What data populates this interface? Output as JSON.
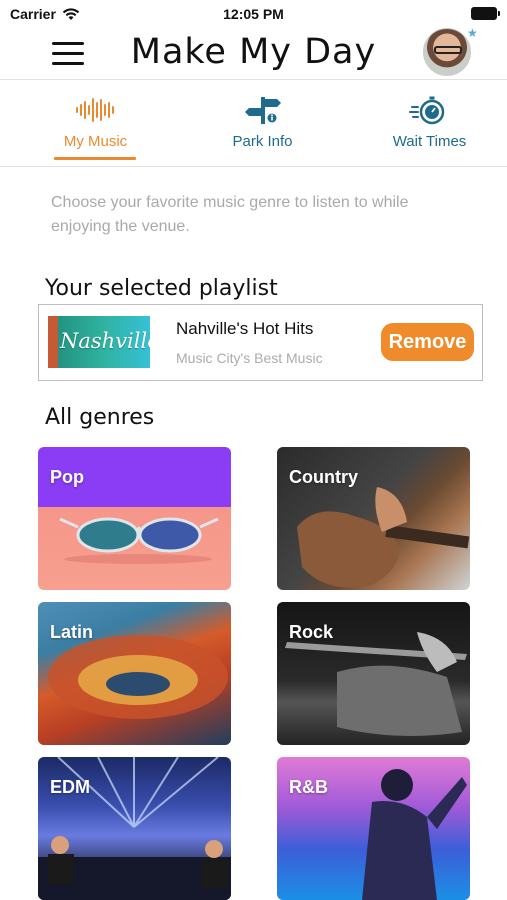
{
  "status_bar": {
    "carrier": "Carrier",
    "time": "12:05 PM"
  },
  "header": {
    "title": "Make My Day",
    "menu_icon": "hamburger-menu-icon",
    "avatar_icon": "user-avatar"
  },
  "tabs": [
    {
      "label": "My Music",
      "icon": "waveform-icon",
      "active": true
    },
    {
      "label": "Park Info",
      "icon": "signpost-icon",
      "active": false
    },
    {
      "label": "Wait Times",
      "icon": "stopwatch-icon",
      "active": false
    }
  ],
  "intro_text": "Choose your favorite music genre to listen to while enjoying the venue.",
  "playlist_section": {
    "title": "Your selected playlist",
    "playlist": {
      "thumbnail_text": "Nashville",
      "name": "Nahville's Hot Hits",
      "description": "Music City's Best Music",
      "remove_label": "Remove"
    }
  },
  "genres_section": {
    "title": "All genres",
    "genres": [
      {
        "label": "Pop"
      },
      {
        "label": "Country"
      },
      {
        "label": "Latin"
      },
      {
        "label": "Rock"
      },
      {
        "label": "EDM"
      },
      {
        "label": "R&B"
      }
    ]
  },
  "colors": {
    "accent_orange": "#f08b2c",
    "tab_blue": "#1f6a8e",
    "muted_text": "#a9a9a9"
  }
}
